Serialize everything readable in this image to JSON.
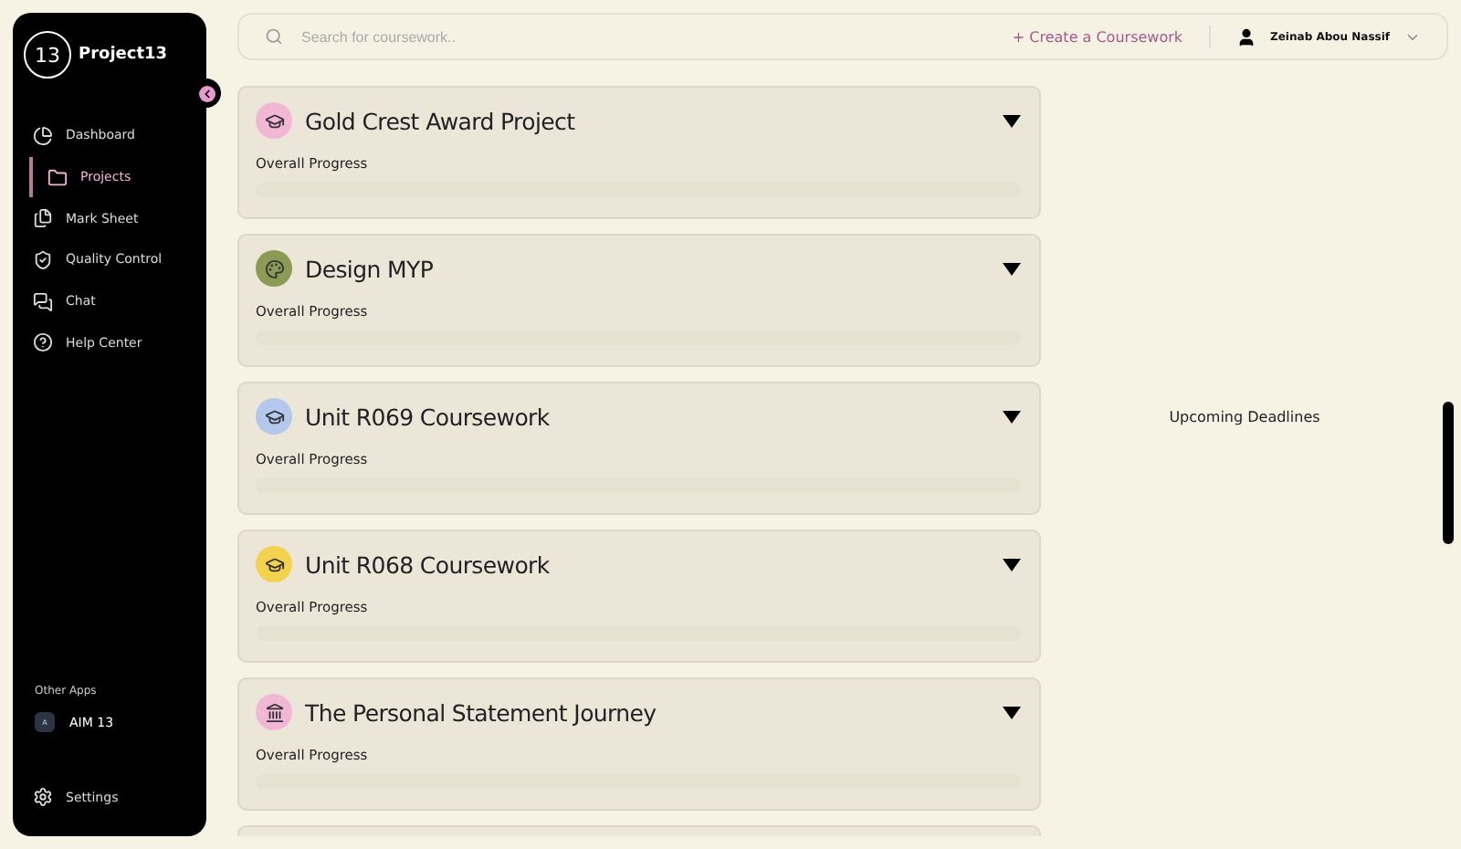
{
  "sidebar": {
    "brand": "Project13",
    "logo": "13",
    "items": [
      {
        "kind": "dashboard",
        "label": "Dashboard",
        "selected": false
      },
      {
        "kind": "projects",
        "label": "Projects",
        "selected": true
      },
      {
        "kind": "marks",
        "label": "Mark Sheet",
        "selected": false
      },
      {
        "kind": "quality",
        "label": "Quality Control",
        "selected": false
      },
      {
        "kind": "chat",
        "label": "Chat",
        "selected": false
      },
      {
        "kind": "help",
        "label": "Help Center",
        "selected": false
      }
    ],
    "other_apps_title": "Other Apps",
    "other_apps": [
      {
        "badge": "A",
        "label": "AIM 13"
      }
    ],
    "settings": "Settings"
  },
  "topbar": {
    "search": {
      "placeholder": "Search for coursework.."
    },
    "create": "+ Create a Coursework",
    "user": "Zeinab Abou Nassif"
  },
  "projects": [
    {
      "kind": "cap",
      "color": "#f3b7d6",
      "title": "Gold Crest Award Project",
      "progress_label": "Overall Progress"
    },
    {
      "kind": "palette",
      "color": "#8c9a55",
      "title": "Design MYP",
      "progress_label": "Overall Progress"
    },
    {
      "kind": "cap",
      "color": "#b3c8ec",
      "title": "Unit R069 Coursework",
      "progress_label": "Overall Progress"
    },
    {
      "kind": "cap",
      "color": "#f2d24f",
      "title": "Unit R068 Coursework",
      "progress_label": "Overall Progress"
    },
    {
      "kind": "building",
      "color": "#f3b7d6",
      "title": "The Personal Statement Journey",
      "progress_label": "Overall Progress"
    }
  ],
  "deadlines": {
    "title": "Upcoming Deadlines"
  }
}
